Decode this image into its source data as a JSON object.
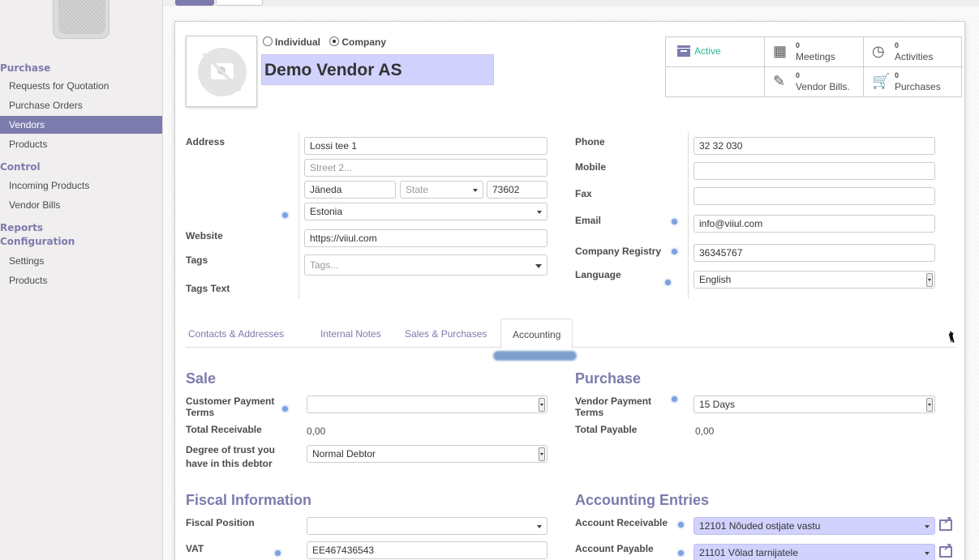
{
  "sidebar": {
    "sections": [
      {
        "label": "Purchase",
        "items": [
          "Requests for Quotation",
          "Purchase Orders",
          "Vendors",
          "Products"
        ]
      },
      {
        "label": "Control",
        "items": [
          "Incoming Products",
          "Vendor Bills"
        ]
      },
      {
        "label": "Reports",
        "items": []
      },
      {
        "label": "Configuration",
        "items": [
          "Settings",
          "Products"
        ]
      }
    ],
    "active_item": "Vendors"
  },
  "header": {
    "type_options": [
      "Individual",
      "Company"
    ],
    "type_selected": "Company",
    "partner_name": "Demo Vendor AS"
  },
  "smart_buttons": {
    "active": "Active",
    "meetings": {
      "count": "0",
      "label": "Meetings"
    },
    "activities": {
      "count": "0",
      "label": "Activities"
    },
    "vendor_bills": {
      "count": "0",
      "label": "Vendor Bills."
    },
    "purchases": {
      "count": "0",
      "label": "Purchases"
    }
  },
  "left_form": {
    "address_label": "Address",
    "street": "Lossi tee 1",
    "street2_placeholder": "Street 2...",
    "city": "Jäneda",
    "state_placeholder": "State",
    "zip": "73602",
    "country": "Estonia",
    "website_label": "Website",
    "website": "https://viiul.com",
    "tags_label": "Tags",
    "tags_placeholder": "Tags...",
    "tags_text_label": "Tags Text"
  },
  "right_form": {
    "phone_label": "Phone",
    "phone": "32 32 030",
    "mobile_label": "Mobile",
    "mobile": "",
    "fax_label": "Fax",
    "fax": "",
    "email_label": "Email",
    "email": "info@viiul.com",
    "registry_label": "Company Registry",
    "registry": "36345767",
    "language_label": "Language",
    "language": "English"
  },
  "tabs": [
    "Contacts & Addresses",
    "Internal Notes",
    "Sales & Purchases",
    "Accounting"
  ],
  "active_tab": "Accounting",
  "sale": {
    "title": "Sale",
    "payment_terms_label_1": "Customer Payment",
    "payment_terms_label_2": "Terms",
    "payment_terms": "",
    "receivable_label": "Total Receivable",
    "receivable": "0,00",
    "trust_label_1": "Degree of trust you",
    "trust_label_2": "have in this debtor",
    "trust": "Normal Debtor"
  },
  "purchase": {
    "title": "Purchase",
    "payment_terms_label_1": "Vendor Payment",
    "payment_terms_label_2": "Terms",
    "payment_terms": "15 Days",
    "payable_label": "Total Payable",
    "payable": "0,00"
  },
  "fiscal": {
    "title": "Fiscal Information",
    "position_label": "Fiscal Position",
    "position": "",
    "vat_label": "VAT",
    "vat": "EE467436543"
  },
  "accounting_entries": {
    "title": "Accounting Entries",
    "receivable_label": "Account Receivable",
    "receivable": "12101 Nõuded ostjate vastu",
    "payable_label": "Account Payable",
    "payable": "21101 Võlad tarnijatele"
  },
  "colors": {
    "accent": "#7c7bad",
    "active_green": "#21b799",
    "required_bg": "#d2d2ff"
  }
}
